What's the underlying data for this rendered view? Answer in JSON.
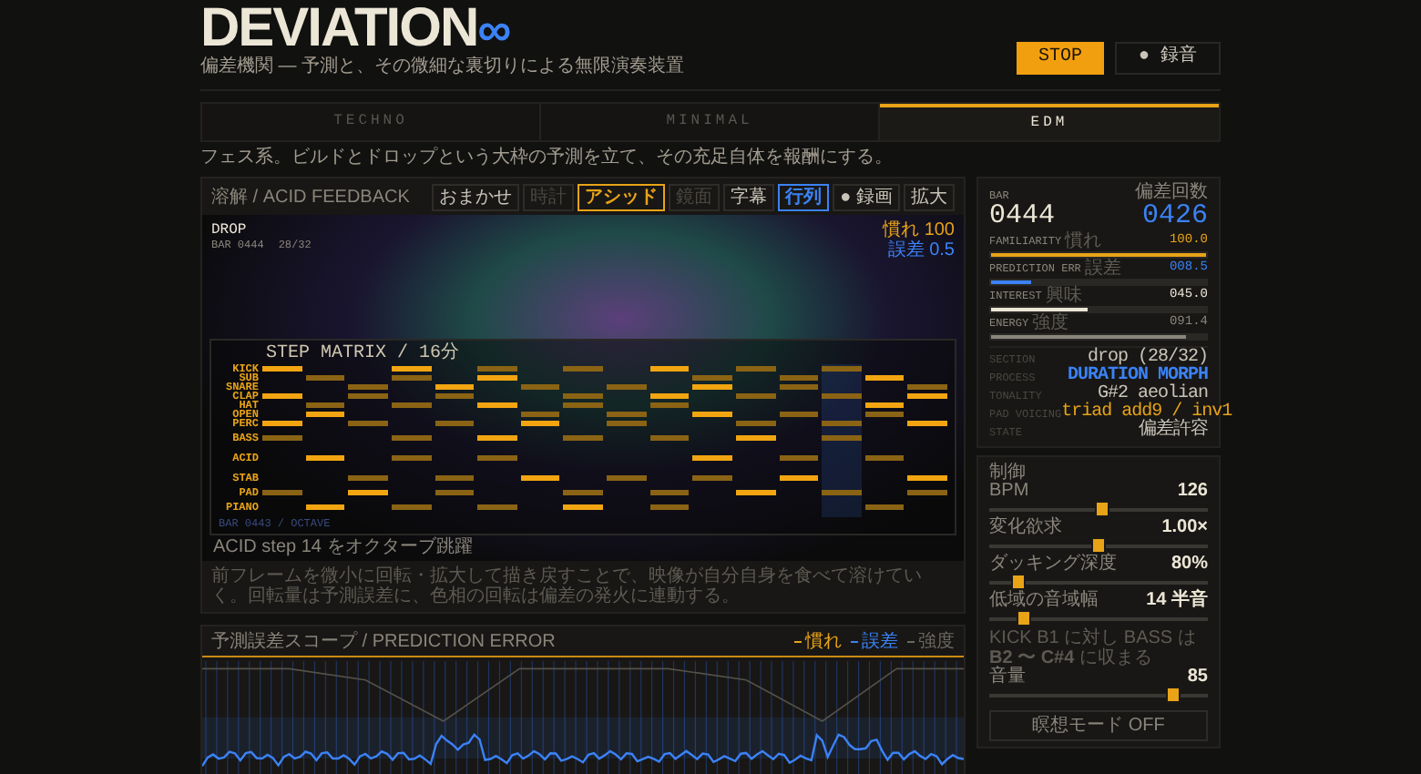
{
  "header": {
    "title": "DEVIATION",
    "title_mark": "∞",
    "subtitle": "偏差機関 — 予測と、その微細な裏切りによる無限演奏装置",
    "buttons": [
      {
        "label": "STOP",
        "kind": "primary"
      },
      {
        "label": "● 録音",
        "kind": "secondary"
      }
    ]
  },
  "tabs": [
    {
      "label": "TECHNO",
      "selected": false
    },
    {
      "label": "MINIMAL",
      "selected": false
    },
    {
      "label": "EDM",
      "selected": true
    }
  ],
  "tab_description": "フェス系。ビルドとドロップという大枠の予測を立て、その充足自体を報酬にする。",
  "visual_panel": {
    "title": "溶解 / ACID FEEDBACK",
    "buttons": [
      {
        "label": "おまかせ",
        "selected": false,
        "disabled": false
      },
      {
        "label": "時計",
        "selected": false,
        "disabled": true
      },
      {
        "label": "アシッド",
        "selected": true,
        "disabled": false,
        "color": "#e8a317"
      },
      {
        "label": "鏡面",
        "selected": false,
        "disabled": true
      },
      {
        "label": "字幕",
        "selected": false,
        "disabled": false
      },
      {
        "label": "行列",
        "selected": true,
        "disabled": false,
        "color": "#3b82f6"
      },
      {
        "label": "● 録画",
        "selected": false,
        "disabled": false
      },
      {
        "label": "拡大",
        "selected": false,
        "disabled": false
      }
    ],
    "section": "DROP",
    "bar": "BAR 0444",
    "position": "28/32",
    "readouts": [
      {
        "label": "慣れ",
        "value": "100",
        "color": "#e8a317"
      },
      {
        "label": "誤差",
        "value": "0.5",
        "color": "#3b82f6"
      }
    ],
    "matrix": {
      "title": "STEP MATRIX / 16分",
      "rows": [
        {
          "label": "KICK",
          "kind": "drum"
        },
        {
          "label": "SUB",
          "kind": "drum"
        },
        {
          "label": "SNARE",
          "kind": "drum"
        },
        {
          "label": "CLAP",
          "kind": "drum"
        },
        {
          "label": "HAT",
          "kind": "drum"
        },
        {
          "label": "OPEN",
          "kind": "drum"
        },
        {
          "label": "PERC",
          "kind": "drum"
        },
        {
          "label": "BASS",
          "kind": "melodic"
        },
        {
          "label": "ACID",
          "kind": "melodic"
        },
        {
          "label": "STAB",
          "kind": "melodic"
        },
        {
          "label": "PAD",
          "kind": "drum"
        },
        {
          "label": "PIANO",
          "kind": "melodic"
        }
      ],
      "footer": "BAR 0443 / OCTAVE",
      "event": "ACID step 14 をオクターブ跳躍"
    },
    "caption": "前フレームを微小に回転・拡大して描き戻すことで、映像が自分自身を食べて溶けていく。回転量は予測誤差に、色相の回転は偏差の発火に連動する。"
  },
  "scope": {
    "title": "予測誤差スコープ / PREDICTION ERROR",
    "legend": [
      {
        "label": "慣れ",
        "color": "#e8a317"
      },
      {
        "label": "誤差",
        "color": "#3b82f6"
      },
      {
        "label": "強度",
        "color": "#6b6760"
      }
    ]
  },
  "stats": {
    "bar_label": "BAR",
    "bar_value": "0444",
    "deviation_label": "偏差回数",
    "deviation_value": "0426",
    "meters": [
      {
        "label": "FAMILIARITY",
        "sub": "慣れ",
        "value": "100.0",
        "level": 1.0,
        "color": "#e8a317"
      },
      {
        "label": "PREDICTION ERR",
        "sub": "誤差",
        "value": "008.5",
        "level": 0.19,
        "color": "#3b82f6"
      },
      {
        "label": "INTEREST",
        "sub": "興味",
        "value": "045.0",
        "level": 0.45,
        "color": "#ece6d6"
      },
      {
        "label": "ENERGY",
        "sub": "強度",
        "value": "091.4",
        "level": 0.91,
        "color": "#8a857b"
      }
    ],
    "info": [
      {
        "label": "SECTION",
        "value": "drop (28/32)",
        "color": "#c9c4b8"
      },
      {
        "label": "PROCESS",
        "value": "DURATION MORPH",
        "color": "#3b82f6"
      },
      {
        "label": "TONALITY",
        "value": "G#2 aeolian",
        "color": "#c9c4b8"
      },
      {
        "label": "PAD VOICING",
        "value": "triad add9 / inv1",
        "color": "#e8a317"
      },
      {
        "label": "STATE",
        "value": "偏差許容",
        "color": "#c9c4b8"
      }
    ]
  },
  "controls": {
    "title": "制御",
    "sliders": [
      {
        "label": "BPM",
        "value": "126",
        "level": 0.52
      },
      {
        "label": "変化欲求",
        "value": "1.00×",
        "level": 0.5
      },
      {
        "label": "ダッキング深度",
        "value": "80%",
        "level": 0.13
      },
      {
        "label": "低域の音域幅",
        "value": "14 半音",
        "level": 0.16,
        "note": "KICK B1 に対し BASS は **B2 〜 C#4** に収まる"
      },
      {
        "label": "音量",
        "value": "85",
        "level": 0.84
      }
    ],
    "button": "瞑想モード OFF"
  }
}
